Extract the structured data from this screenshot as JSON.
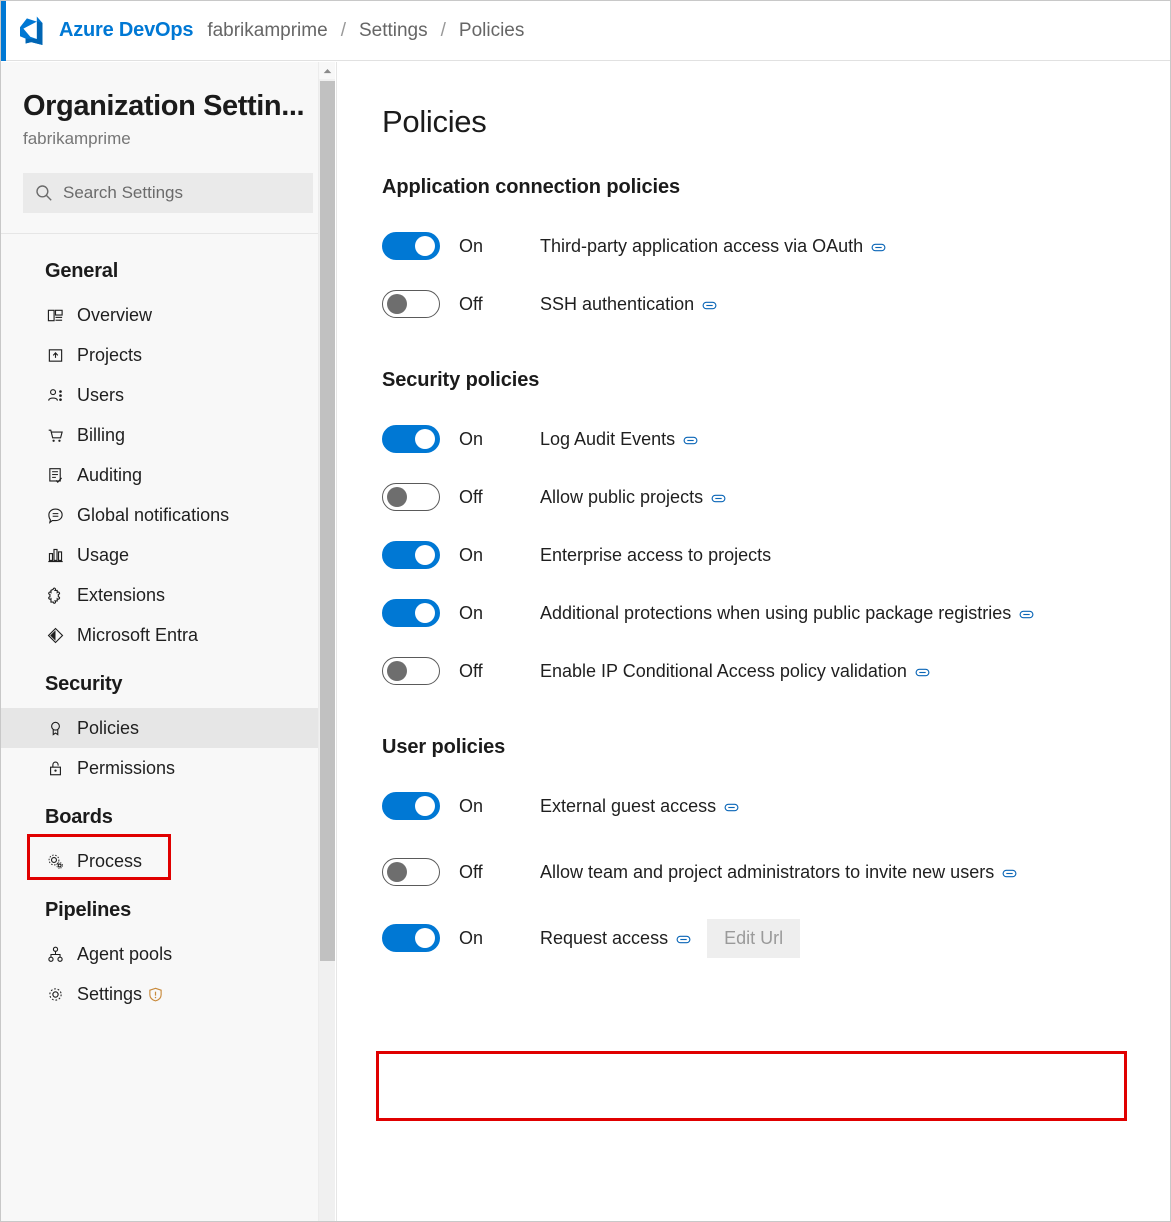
{
  "header": {
    "logo_icon": "azure-devops-logo",
    "brand": "Azure DevOps",
    "breadcrumb": [
      "fabrikamprime",
      "Settings",
      "Policies"
    ],
    "separator": "/",
    "accent_color": "#0078d4"
  },
  "sidebar": {
    "title": "Organization Settin...",
    "subtitle": "fabrikamprime",
    "search": {
      "placeholder": "Search Settings",
      "value": "",
      "icon": "search-icon"
    },
    "groups": [
      {
        "title": "General",
        "items": [
          {
            "label": "Overview",
            "icon": "overview-icon",
            "selected": false
          },
          {
            "label": "Projects",
            "icon": "projects-icon",
            "selected": false
          },
          {
            "label": "Users",
            "icon": "users-icon",
            "selected": false
          },
          {
            "label": "Billing",
            "icon": "billing-cart-icon",
            "selected": false
          },
          {
            "label": "Auditing",
            "icon": "auditing-icon",
            "selected": false
          },
          {
            "label": "Global notifications",
            "icon": "notifications-icon",
            "selected": false
          },
          {
            "label": "Usage",
            "icon": "usage-chart-icon",
            "selected": false
          },
          {
            "label": "Extensions",
            "icon": "extensions-puzzle-icon",
            "selected": false
          },
          {
            "label": "Microsoft Entra",
            "icon": "microsoft-entra-icon",
            "selected": false
          }
        ]
      },
      {
        "title": "Security",
        "items": [
          {
            "label": "Policies",
            "icon": "policies-ribbon-icon",
            "selected": true,
            "highlighted": true
          },
          {
            "label": "Permissions",
            "icon": "permissions-lock-icon",
            "selected": false
          }
        ]
      },
      {
        "title": "Boards",
        "items": [
          {
            "label": "Process",
            "icon": "process-gear-icon",
            "selected": false
          }
        ]
      },
      {
        "title": "Pipelines",
        "items": [
          {
            "label": "Agent pools",
            "icon": "agent-pools-icon",
            "selected": false
          },
          {
            "label": "Settings",
            "icon": "settings-gear-icon",
            "selected": false,
            "badge_icon": "shield-warning-icon"
          }
        ]
      }
    ],
    "scrollbar": {
      "up_arrow_icon": "chevron-up-icon"
    }
  },
  "main": {
    "page_title": "Policies",
    "sections": [
      {
        "title": "Application connection policies",
        "policies": [
          {
            "state": "On",
            "enabled": true,
            "label": "Third-party application access via OAuth",
            "has_link": true
          },
          {
            "state": "Off",
            "enabled": false,
            "label": "SSH authentication",
            "has_link": true
          }
        ]
      },
      {
        "title": "Security policies",
        "policies": [
          {
            "state": "On",
            "enabled": true,
            "label": "Log Audit Events",
            "has_link": true
          },
          {
            "state": "Off",
            "enabled": false,
            "label": "Allow public projects",
            "has_link": true
          },
          {
            "state": "On",
            "enabled": true,
            "label": "Enterprise access to projects",
            "has_link": false
          },
          {
            "state": "On",
            "enabled": true,
            "label": "Additional protections when using public package registries",
            "has_link": true
          },
          {
            "state": "Off",
            "enabled": false,
            "label": "Enable IP Conditional Access policy validation",
            "has_link": true
          }
        ]
      },
      {
        "title": "User policies",
        "policies": [
          {
            "state": "On",
            "enabled": true,
            "label": "External guest access",
            "has_link": true
          },
          {
            "state": "Off",
            "enabled": false,
            "label": "Allow team and project administrators to invite new users",
            "has_link": true,
            "highlighted": true
          },
          {
            "state": "On",
            "enabled": true,
            "label": "Request access",
            "has_link": true,
            "button": "Edit Url"
          }
        ]
      }
    ]
  },
  "annotations": {
    "highlight_color": "#e00000"
  }
}
